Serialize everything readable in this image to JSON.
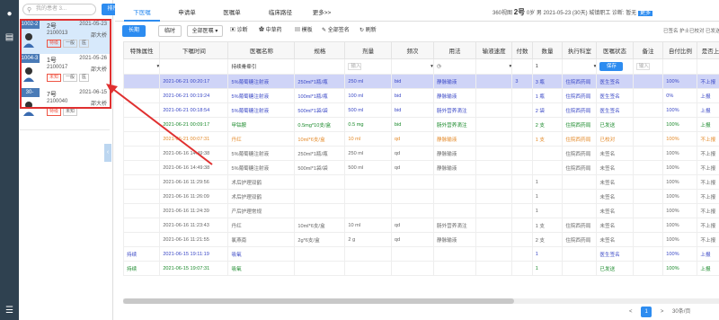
{
  "search": {
    "placeholder": "我的患者 3...",
    "sort_label": "排序"
  },
  "patients": [
    {
      "bed": "1002-2",
      "name": "2号",
      "date": "2021-05-23",
      "no": "2100013",
      "doctor": "邵大桥",
      "tags": [
        "特级",
        "一般",
        "医"
      ]
    },
    {
      "bed": "1004-3",
      "name": "1号",
      "date": "2021-05-26",
      "no": "2100017",
      "doctor": "邵大桥",
      "tags": [
        "未知",
        "一般",
        "医"
      ]
    },
    {
      "bed": "30-1001",
      "name": "7号",
      "date": "2021-06-15",
      "no": "2100040",
      "doctor": "邵大桥",
      "tags": [
        "特级",
        "未知"
      ]
    }
  ],
  "tabs": [
    "下医嘱",
    "申请单",
    "医嘱单",
    "临床路径",
    "更多>>"
  ],
  "patient_info": {
    "hospital": "360视图",
    "bed": "2号",
    "age": "0岁",
    "sex": "男",
    "date": "2021-05-23",
    "days": "(30天)",
    "insurance": "城镇职工",
    "diag": "诊断:",
    "diag_value": "暂无",
    "more": "更多"
  },
  "legend": "已签名 护士已校对 已发送 已停止",
  "toolbar": {
    "long": "长期",
    "temp": "临时",
    "all": "全部医嘱",
    "diagnose": "诊断",
    "herb": "中草药",
    "template": "模板",
    "sign_all": "全部签名",
    "refresh": "刷新"
  },
  "columns": [
    "特殊属性",
    "下嘱时间",
    "医嘱名称",
    "规格",
    "剂量",
    "频次",
    "用法",
    "输液速度",
    "付数",
    "数量",
    "执行科室",
    "医嘱状态",
    "备注",
    "自付比例",
    "是否上报",
    "是否"
  ],
  "edit_row": {
    "name": "持续骨牵引",
    "dose_placeholder": "输入",
    "qty": "1",
    "save": "保存",
    "remark_placeholder": "输入"
  },
  "rows": [
    {
      "c": "blue",
      "hl": true,
      "cells": [
        "",
        "2021-06-21 00:20:17",
        "5%葡萄糖注射液",
        "250ml*1瓶/瓶",
        "250 ml",
        "bid",
        "静脉输液",
        "",
        "3",
        "3 瓶",
        "住院西药局",
        "医生签名",
        "",
        "100%",
        "不上报",
        "是"
      ]
    },
    {
      "c": "blue",
      "cells": [
        "",
        "2021-06-21 00:19:24",
        "5%葡萄糖注射液",
        "100ml*1瓶/瓶",
        "100 ml",
        "bid",
        "静脉输液",
        "",
        "",
        "1 瓶",
        "住院西药局",
        "医生签名",
        "",
        "0%",
        "上报",
        "是"
      ]
    },
    {
      "c": "blue",
      "cells": [
        "",
        "2021-06-21 00:18:54",
        "5%葡萄糖注射液",
        "500ml*1袋/袋",
        "500 ml",
        "bid",
        "肠外营养滴注",
        "",
        "",
        "2 袋",
        "住院西药局",
        "医生签名",
        "",
        "100%",
        "上报",
        "是"
      ]
    },
    {
      "c": "green",
      "cells": [
        "",
        "2021-06-21 00:09:17",
        "甲钴胺",
        "0.5mg*10支/盒",
        "0.5 mg",
        "bid",
        "肠外营养滴注",
        "",
        "",
        "2 支",
        "住院西药局",
        "已发送",
        "",
        "100%",
        "上报",
        "是"
      ]
    },
    {
      "c": "orange",
      "cells": [
        "",
        "2021-06-21 00:07:31",
        "丹红",
        "10ml*6支/盒",
        "10 ml",
        "qd",
        "静脉输液",
        "",
        "",
        "1 支",
        "住院西药局",
        "已校对",
        "",
        "100%",
        "不上报",
        "是"
      ]
    },
    {
      "c": "gray",
      "cells": [
        "",
        "2021-06-16 14:49:38",
        "5%葡萄糖注射液",
        "250ml*1瓶/瓶",
        "250 ml",
        "qd",
        "静脉输液",
        "",
        "",
        "",
        "住院西药局",
        "未签名",
        "",
        "100%",
        "不上报",
        "是"
      ]
    },
    {
      "c": "gray",
      "cells": [
        "",
        "2021-06-16 14:49:38",
        "5%葡萄糖注射液",
        "500ml*1袋/袋",
        "500 ml",
        "qd",
        "静脉输液",
        "",
        "",
        "",
        "住院西药局",
        "未签名",
        "",
        "100%",
        "不上报",
        "是"
      ]
    },
    {
      "c": "gray",
      "cells": [
        "",
        "2021-06-16 11:29:56",
        "术后护理双鹤",
        "",
        "",
        "",
        "",
        "",
        "",
        "1",
        "",
        "未签名",
        "",
        "100%",
        "不上报",
        "是"
      ]
    },
    {
      "c": "gray",
      "cells": [
        "",
        "2021-06-16 11:26:09",
        "术后护理双鹤",
        "",
        "",
        "",
        "",
        "",
        "",
        "1",
        "",
        "未签名",
        "",
        "100%",
        "不上报",
        "是"
      ]
    },
    {
      "c": "gray",
      "cells": [
        "",
        "2021-06-16 11:24:39",
        "产后护理常规",
        "",
        "",
        "",
        "",
        "",
        "",
        "1",
        "",
        "未签名",
        "",
        "100%",
        "不上报",
        "是"
      ]
    },
    {
      "c": "gray",
      "cells": [
        "",
        "2021-06-16 11:23:43",
        "丹红",
        "10ml*6支/盒",
        "10 ml",
        "qd",
        "肠外营养滴注",
        "",
        "",
        "1 支",
        "住院西药局",
        "未签名",
        "",
        "100%",
        "不上报",
        "是"
      ]
    },
    {
      "c": "gray",
      "cells": [
        "",
        "2021-06-16 11:21:55",
        "氯燕南",
        "2g*6支/盒",
        "2 g",
        "qd",
        "静脉输液",
        "",
        "",
        "2 支",
        "住院西药局",
        "未签名",
        "",
        "100%",
        "不上报",
        "是"
      ]
    },
    {
      "c": "blue",
      "cells": [
        "持续",
        "2021-06-15 19:11:19",
        "吸氧",
        "",
        "",
        "",
        "",
        "",
        "",
        "1",
        "",
        "医生签名",
        "",
        "100%",
        "上报",
        "是"
      ]
    },
    {
      "c": "green",
      "cells": [
        "持续",
        "2021-06-15 19:07:31",
        "吸氧",
        "",
        "",
        "",
        "",
        "",
        "",
        "1",
        "",
        "已发送",
        "",
        "100%",
        "上报",
        "是"
      ]
    }
  ],
  "pager": {
    "page": "1",
    "size": "30条/页"
  }
}
